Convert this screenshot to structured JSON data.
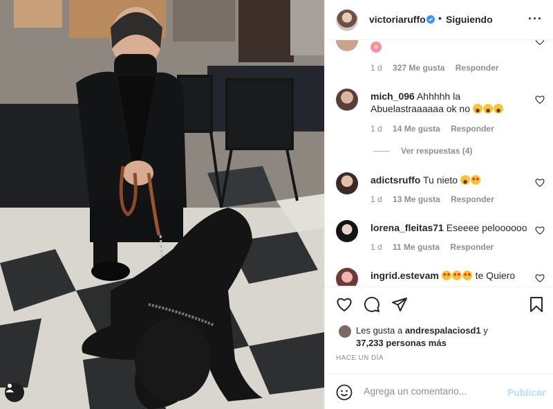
{
  "post": {
    "username": "victoriaruffo",
    "dot": "•",
    "follow_status": "Siguiendo",
    "more_icon": "more-horizontal-icon"
  },
  "comments": [
    {
      "user": "",
      "text": "",
      "emoji": [
        "flower"
      ],
      "age": "1 d",
      "likes": "327 Me gusta",
      "reply": "Responder"
    },
    {
      "user": "mich_096",
      "text": "Ahhhhh la Abuelastraaaaaa ok no",
      "emoji": [
        "laugh",
        "laugh",
        "laugh"
      ],
      "age": "1 d",
      "likes": "14 Me gusta",
      "reply": "Responder"
    },
    {
      "user": "adictsruffo",
      "text": "Tu nieto",
      "emoji": [
        "laugh",
        "star-eyes"
      ],
      "age": "1 d",
      "likes": "13 Me gusta",
      "reply": "Responder"
    },
    {
      "user": "lorena_fleitas71",
      "text": "Eseeee peloooooo",
      "emoji": [],
      "age": "1 d",
      "likes": "11 Me gusta",
      "reply": "Responder"
    },
    {
      "user": "ingrid.estevam",
      "text": "te Quiero",
      "emoji": [
        "star-eyes",
        "star-eyes",
        "star-eyes"
      ],
      "age": "",
      "likes": "",
      "reply": ""
    }
  ],
  "view_replies": "Ver respuestas (4)",
  "likes": {
    "prefix": "Les gusta a ",
    "user": "andrespalaciosd1",
    "suffix": " y",
    "others": "37,233 personas más"
  },
  "timeago": "HACE UN DÍA",
  "composer": {
    "placeholder": "Agrega un comentario...",
    "post_label": "Publicar"
  },
  "colors": {
    "verified": "#3897f0",
    "publish_disabled": "#b2dffc",
    "muted": "#8e8e8e"
  }
}
